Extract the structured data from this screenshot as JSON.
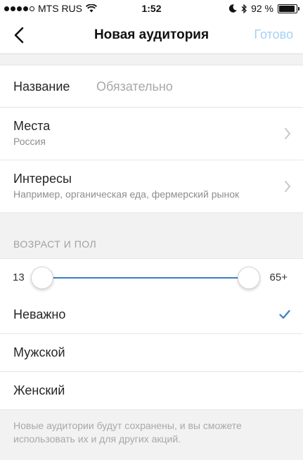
{
  "status_bar": {
    "carrier": "MTS RUS",
    "time": "1:52",
    "battery_text": "92 %",
    "battery_level": 0.92,
    "signal_bars_filled": 4,
    "signal_bars_total": 5,
    "icons": [
      "wifi-icon",
      "moon-icon",
      "bluetooth-icon",
      "battery-icon"
    ]
  },
  "nav": {
    "back_icon": "chevron-left-icon",
    "title": "Новая аудитория",
    "done_label": "Готово"
  },
  "form": {
    "name_label": "Название",
    "name_value": "",
    "name_placeholder": "Обязательно",
    "places_label": "Места",
    "places_value": "Россия",
    "interests_label": "Интересы",
    "interests_hint": "Например, органическая еда, фермерский рынок"
  },
  "age_gender": {
    "section_title": "ВОЗРАСТ И ПОЛ",
    "age_min_label": "13",
    "age_max_label": "65+",
    "slider_low_fraction": 0.0,
    "slider_high_fraction": 1.0,
    "options": [
      "Неважно",
      "Мужской",
      "Женский"
    ],
    "selected_option": "Неважно"
  },
  "footer_note": "Новые аудитории будут сохранены, и вы сможете использовать их и для других акций.",
  "colors": {
    "accent": "#3a7fc1",
    "done_disabled": "#a7d0f5",
    "background": "#f2f2f2"
  }
}
